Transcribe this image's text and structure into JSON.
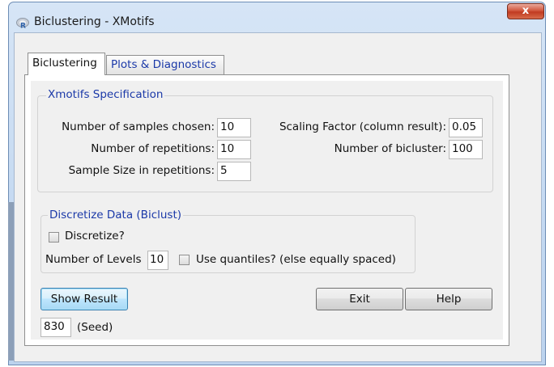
{
  "window": {
    "title": "Biclustering - XMotifs",
    "close_label": "x"
  },
  "tabs": [
    {
      "label": "Biclustering",
      "active": true
    },
    {
      "label": "Plots & Diagnostics",
      "active": false
    }
  ],
  "xmotifs": {
    "title": "Xmotifs Specification",
    "samples_label": "Number of samples chosen:",
    "samples_value": "10",
    "repetitions_label": "Number of repetitions:",
    "repetitions_value": "10",
    "sample_size_label": "Sample Size in repetitions:",
    "sample_size_value": "5",
    "scaling_label": "Scaling Factor (column result):",
    "scaling_value": "0.05",
    "bicluster_label": "Number of bicluster:",
    "bicluster_value": "100"
  },
  "discretize": {
    "title": "Discretize Data (Biclust)",
    "discretize_label": "Discretize?",
    "discretize_checked": false,
    "levels_label": "Number of Levels",
    "levels_value": "10",
    "quantiles_label": "Use quantiles? (else equally spaced)",
    "quantiles_checked": false
  },
  "buttons": {
    "show_result": "Show Result",
    "exit": "Exit",
    "help": "Help"
  },
  "seed": {
    "value": "830",
    "label": "(Seed)"
  },
  "colors": {
    "accent_text": "#1b39a8",
    "close_button": "#c13b21",
    "window_frame": "#c4d9f1"
  }
}
